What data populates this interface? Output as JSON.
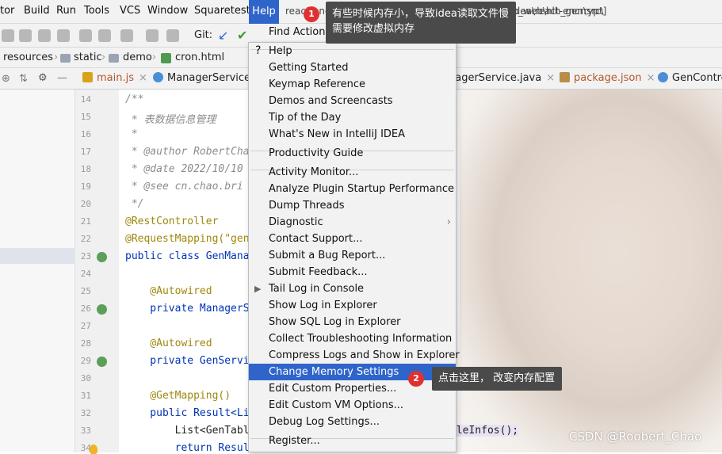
{
  "menubar": {
    "items": [
      "tor",
      "Build",
      "Run",
      "Tools",
      "VCS",
      "Window",
      "Squaretest",
      "Help"
    ],
    "title_left": "react-encrypt [D:\\workspace\\localhost\\tetBrain\\idea\\react-encrrypt]",
    "title_right": "...\\hlh_web\\hlh_gen\\src\\"
  },
  "toolbar": {
    "git_label": "Git:"
  },
  "breadcrumbs": [
    "resources",
    "static",
    "demo",
    "cron.html"
  ],
  "tabs": [
    "main.js",
    "ManagerServiceIm",
    "nagerService.java",
    "package.json",
    "GenContro"
  ],
  "gutter_lines": [
    "14",
    "15",
    "16",
    "17",
    "18",
    "19",
    "20",
    "21",
    "22",
    "23",
    "24",
    "25",
    "26",
    "27",
    "28",
    "29",
    "30",
    "31",
    "32",
    "33",
    "34"
  ],
  "code_lines": [
    "/**",
    " * 表数据信息管理",
    " *",
    " * @author RobertCha",
    " * @date 2022/10/10",
    " * @see cn.chao.bri",
    " */",
    "@RestController",
    "@RequestMapping(\"gen",
    "public class GenMana",
    "",
    "    @Autowired",
    "    private ManagerS",
    "",
    "    @Autowired",
    "    private GenServi",
    "",
    "    @GetMapping()",
    "    public Result<Li",
    "        List<GenTabl",
    "        return Resul"
  ],
  "code_tail": "oleInfos();",
  "help_menu": {
    "items": [
      {
        "label": "Find Action...",
        "shortcut": "Shift+A"
      },
      {
        "label": "Help"
      },
      {
        "label": "Getting Started"
      },
      {
        "label": "Keymap Reference"
      },
      {
        "label": "Demos and Screencasts"
      },
      {
        "label": "Tip of the Day"
      },
      {
        "label": "What's New in IntelliJ IDEA"
      },
      {
        "label": "Productivity Guide"
      },
      {
        "label": "Activity Monitor..."
      },
      {
        "label": "Analyze Plugin Startup Performance"
      },
      {
        "label": "Dump Threads"
      },
      {
        "label": "Diagnostic"
      },
      {
        "label": "Contact Support..."
      },
      {
        "label": "Submit a Bug Report..."
      },
      {
        "label": "Submit Feedback..."
      },
      {
        "label": "Tail Log in Console"
      },
      {
        "label": "Show Log in Explorer"
      },
      {
        "label": "Show SQL Log in Explorer"
      },
      {
        "label": "Collect Troubleshooting Information"
      },
      {
        "label": "Compress Logs and Show in Explorer"
      },
      {
        "label": "Change Memory Settings"
      },
      {
        "label": "Edit Custom Properties..."
      },
      {
        "label": "Edit Custom VM Options..."
      },
      {
        "label": "Debug Log Settings..."
      },
      {
        "label": "Register..."
      }
    ]
  },
  "annotations": {
    "tip1_line1": "有些时候内存小，导致idea读取文件慢",
    "tip1_line2": "需要修改虚拟内存",
    "tip2": "点击这里， 改变内存配置",
    "badge1": "1",
    "badge2": "2"
  },
  "watermark": "CSDN @Roobert_Chao",
  "colors": {
    "accent": "#2f65ca",
    "badge": "#e03131",
    "tooltip": "#4a4a4a"
  }
}
